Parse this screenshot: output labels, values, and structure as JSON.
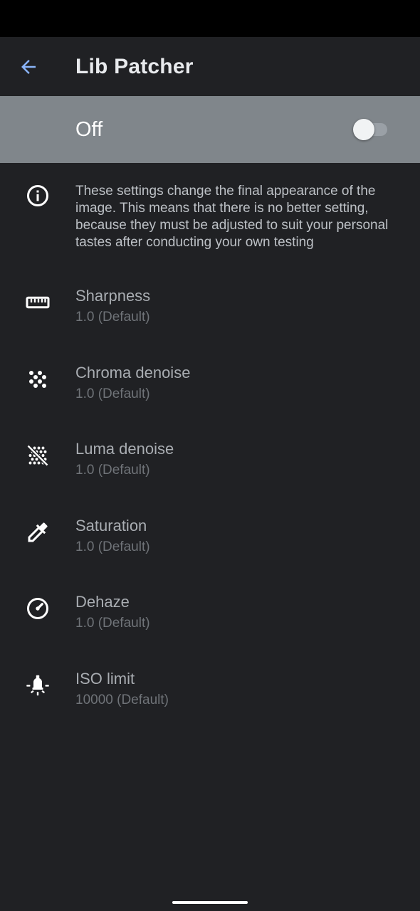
{
  "toolbar": {
    "title": "Lib Patcher",
    "back_icon": "arrow-back-icon"
  },
  "master_switch": {
    "label": "Off",
    "checked": false
  },
  "info": {
    "icon": "info-icon",
    "text": "These settings change the final appearance of the image. This means that there is no better setting, because they must be adjusted to suit your personal tastes after conducting your own testing"
  },
  "preferences": [
    {
      "title": "Sharpness",
      "summary": "1.0 (Default)",
      "icon": "ruler-icon"
    },
    {
      "title": "Chroma denoise",
      "summary": "1.0 (Default)",
      "icon": "dots-grain-icon"
    },
    {
      "title": "Luma denoise",
      "summary": "1.0 (Default)",
      "icon": "grain-off-icon"
    },
    {
      "title": "Saturation",
      "summary": "1.0 (Default)",
      "icon": "eyedropper-icon"
    },
    {
      "title": "Dehaze",
      "summary": "1.0 (Default)",
      "icon": "gauge-icon"
    },
    {
      "title": "ISO limit",
      "summary": "10000 (Default)",
      "icon": "light-bulb-icon"
    }
  ],
  "colors": {
    "background": "#202124",
    "accent": "#8ab4f8",
    "switch_bar": "#80868b"
  }
}
